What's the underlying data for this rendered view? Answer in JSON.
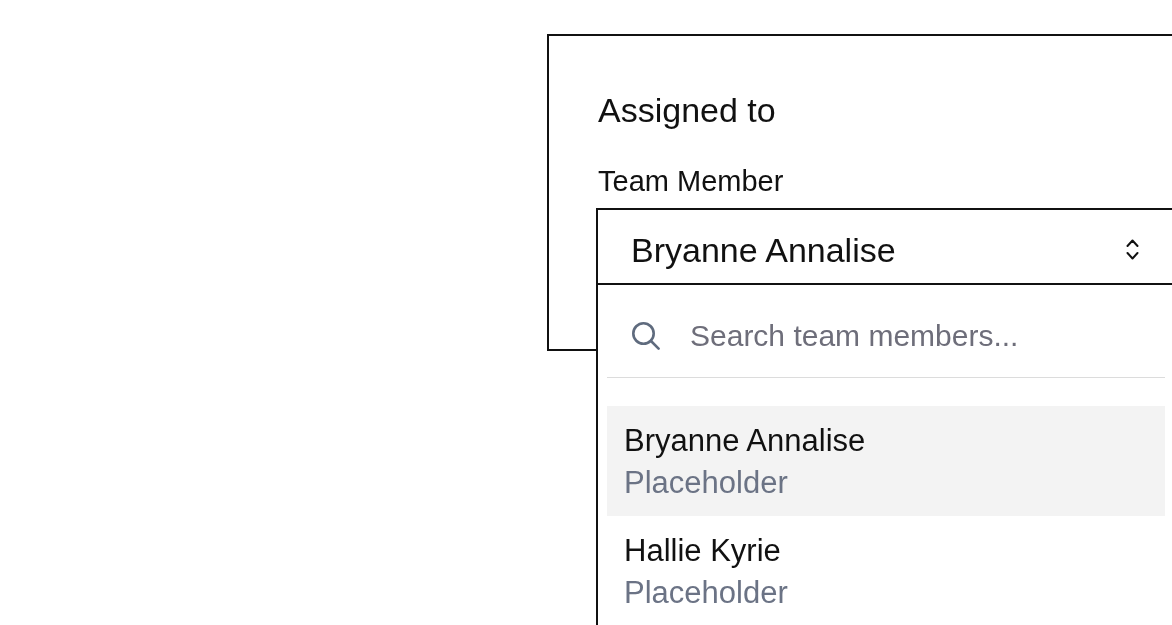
{
  "card": {
    "title": "Assigned to",
    "field": {
      "label": "Team Member",
      "value": "Bryanne Annalise",
      "open": true
    },
    "dropdown": {
      "search": {
        "placeholder": "Search team members..."
      },
      "options": [
        {
          "name": "Bryanne Annalise",
          "subtitle": "Placeholder",
          "selected": true
        },
        {
          "name": "Hallie Kyrie",
          "subtitle": "Placeholder",
          "selected": false
        }
      ]
    }
  }
}
